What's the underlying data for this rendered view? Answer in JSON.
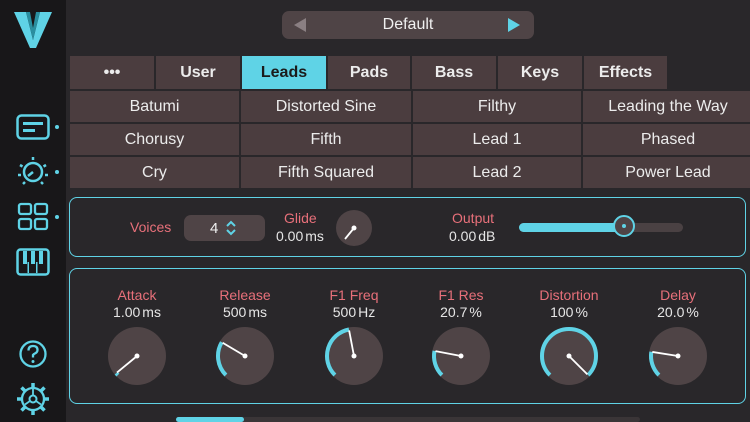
{
  "preset": {
    "name": "Default"
  },
  "tabs": [
    {
      "label": "•••"
    },
    {
      "label": "User"
    },
    {
      "label": "Leads"
    },
    {
      "label": "Pads"
    },
    {
      "label": "Bass"
    },
    {
      "label": "Keys"
    },
    {
      "label": "Effects"
    }
  ],
  "active_tab": "Leads",
  "presets": [
    [
      "Batumi",
      "Distorted Sine",
      "Filthy",
      "Leading the Way"
    ],
    [
      "Chorusy",
      "Fifth",
      "Lead 1",
      "Phased"
    ],
    [
      "Cry",
      "Fifth Squared",
      "Lead 2",
      "Power Lead"
    ]
  ],
  "voices": {
    "label": "Voices",
    "value": "4"
  },
  "glide": {
    "label": "Glide",
    "value": "0.00",
    "unit": "ms"
  },
  "output": {
    "label": "Output",
    "value": "0.00",
    "unit": "dB",
    "level": 0.64
  },
  "knobs": [
    {
      "label": "Attack",
      "value": "1.00",
      "unit": "ms",
      "level": 0.02
    },
    {
      "label": "Release",
      "value": "500",
      "unit": "ms",
      "level": 0.28
    },
    {
      "label": "F1 Freq",
      "value": "500",
      "unit": "Hz",
      "level": 0.46
    },
    {
      "label": "F1 Res",
      "value": "20.7",
      "unit": "%",
      "level": 0.207
    },
    {
      "label": "Distortion",
      "value": "100",
      "unit": "%",
      "level": 1.0
    },
    {
      "label": "Delay",
      "value": "20.0",
      "unit": "%",
      "level": 0.2
    }
  ],
  "colors": {
    "accent": "#5fd3e6",
    "label_red": "#e8707a",
    "button_bg": "#4b3d3f"
  },
  "sidebar_icons": [
    "logo-icon",
    "keyboard-mode-icon",
    "knob-mode-icon",
    "grid-mode-icon",
    "piano-icon",
    "help-icon",
    "settings-gear-icon"
  ]
}
